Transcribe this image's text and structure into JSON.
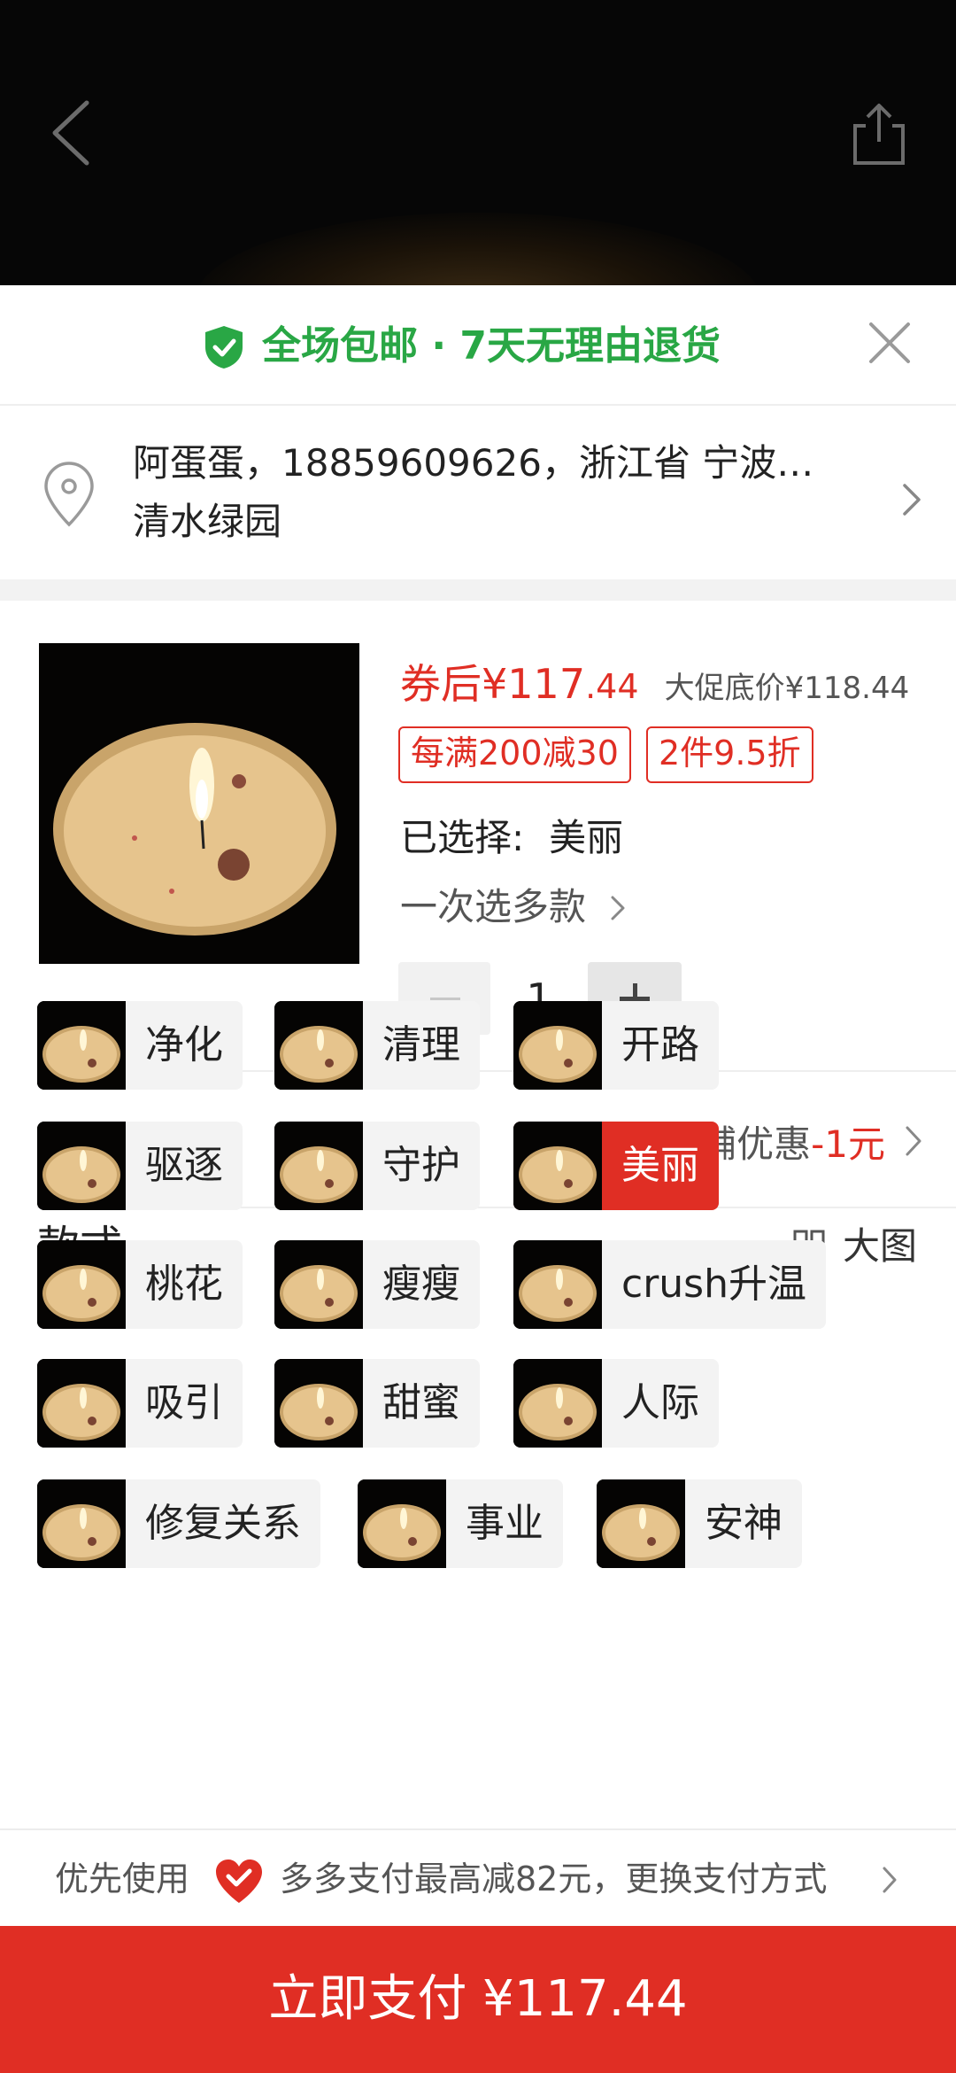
{
  "nav": {
    "back_icon": "chevron-left-icon",
    "share_icon": "share-icon"
  },
  "banner": {
    "text": "全场包邮 · 7天无理由退货",
    "color": "#29a745"
  },
  "address": {
    "line1": "阿蛋蛋，18859609626，浙江省 宁波…",
    "line2": "清水绿园"
  },
  "product": {
    "price_prefix": "券后¥",
    "price_int": "117",
    "price_cents": ".44",
    "promo_price": "大促底价¥118.44",
    "tags": [
      "每满200减30",
      "2件9.5折"
    ],
    "selected_label": "已选择:",
    "selected_value": "美丽",
    "multi_select": "一次选多款",
    "quantity": "1"
  },
  "discount": {
    "label": "优惠",
    "shop_discount": "店铺优惠",
    "amount": "-1元"
  },
  "styles": {
    "label": "款式",
    "big_pic": "大图",
    "options": [
      "净化",
      "清理",
      "开路",
      "驱逐",
      "守护",
      "美丽",
      "桃花",
      "瘦瘦",
      "crush升温",
      "吸引",
      "甜蜜",
      "人际",
      "修复关系",
      "事业",
      "安神"
    ],
    "selected": "美丽"
  },
  "payment": {
    "prefer": "优先使用",
    "offer": "多多支付最高减82元，更换支付方式",
    "button": "立即支付 ¥117.44"
  },
  "colors": {
    "accent": "#e02e24",
    "green": "#29a745"
  }
}
